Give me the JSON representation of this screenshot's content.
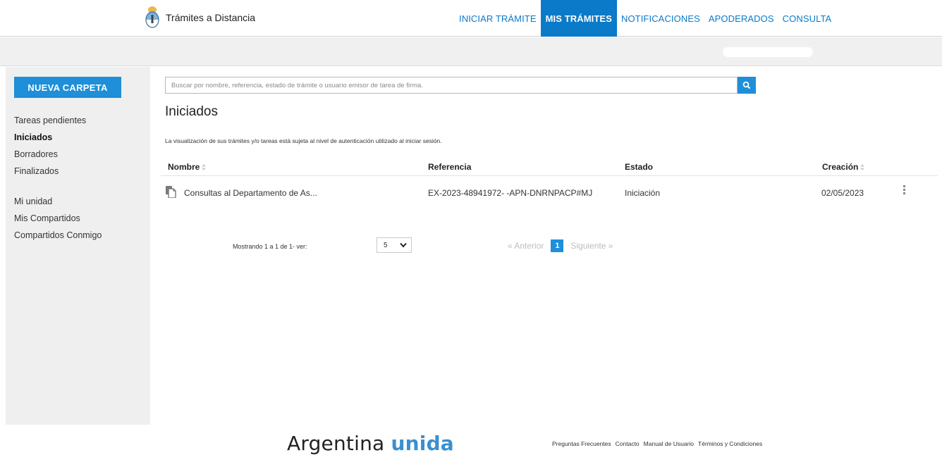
{
  "header": {
    "brand_name": "Trámites a Distancia",
    "nav": [
      {
        "label": "INICIAR TRÁMITE",
        "active": false
      },
      {
        "label": "MIS TRÁMITES",
        "active": true
      },
      {
        "label": "NOTIFICACIONES",
        "active": false
      },
      {
        "label": "APODERADOS",
        "active": false
      },
      {
        "label": "CONSULTA",
        "active": false
      }
    ]
  },
  "sidebar": {
    "new_folder_label": "NUEVA CARPETA",
    "items": [
      {
        "label": "Tareas pendientes"
      },
      {
        "label": "Iniciados"
      },
      {
        "label": "Borradores"
      },
      {
        "label": "Finalizados"
      },
      {
        "label": "Mi unidad"
      },
      {
        "label": "Mis Compartidos"
      },
      {
        "label": "Compartidos Conmigo"
      }
    ],
    "selected": "Iniciados"
  },
  "search": {
    "placeholder": "Buscar por nombre, referencia, estado de trámite o usuario emisor de tarea de firma."
  },
  "main": {
    "title": "Iniciados",
    "notice": "La visualización de sus trámites y/o tareas está sujeta al nivel de autenticación utilizado al iniciar sesión.",
    "columns": [
      "Nombre",
      "Referencia",
      "Estado",
      "Creación"
    ],
    "rows": [
      {
        "nombre": "Consultas al Departamento de As...",
        "referencia": "EX-2023-48941972- -APN-DNRNPACP#MJ",
        "estado": "Iniciación",
        "creacion": "02/05/2023"
      }
    ]
  },
  "pagination": {
    "showing": "Mostrando 1 a 1 de 1- ver:",
    "per_page": "5",
    "prev": "« Anterior",
    "current_page": "1",
    "next": "Siguiente »"
  },
  "footer": {
    "logo_word1": "Argentina",
    "logo_word2": "unida",
    "links": [
      "Preguntas Frecuentes",
      "Contacto",
      "Manual de Usuario",
      "Términos y Condiciones"
    ]
  },
  "colors": {
    "primary": "#1e8fd8",
    "nav_text": "#0a7ac9",
    "sidebar_bg": "#efefef"
  }
}
